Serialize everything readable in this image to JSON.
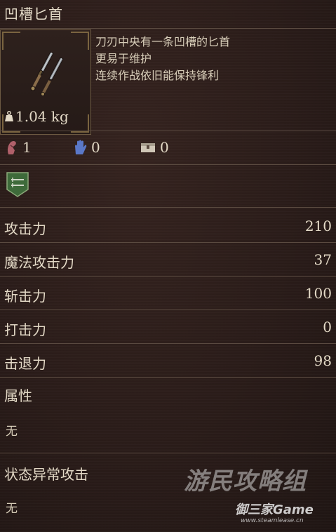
{
  "item": {
    "name": "凹槽匕首",
    "weight": "1.04 kg",
    "description": [
      "刀刃中央有一条凹槽的匕首",
      "更易于维护",
      "连续作战依旧能保持锋利"
    ]
  },
  "requirements": [
    {
      "icon": "strength-arm-icon",
      "value": "1"
    },
    {
      "icon": "magic-hand-icon",
      "value": "0"
    },
    {
      "icon": "chest-icon",
      "value": "0"
    }
  ],
  "class_badge_icon": "dagger-class-badge-icon",
  "stats": [
    {
      "label": "攻击力",
      "value": "210"
    },
    {
      "label": "魔法攻击力",
      "value": "37"
    },
    {
      "label": "斩击力",
      "value": "100"
    },
    {
      "label": "打击力",
      "value": "0"
    },
    {
      "label": "击退力",
      "value": "98"
    }
  ],
  "attribute": {
    "label": "属性",
    "value": "无"
  },
  "status_attack": {
    "label": "状态异常攻击",
    "value": "无"
  },
  "watermark": {
    "line1": "游民攻略组",
    "line2": "御三家Game",
    "line3": "www.steamlease.cn"
  },
  "colors": {
    "background": "#2a1d1a",
    "text": "#e3d9c6",
    "divider": "#5a4a40",
    "frame_gold": "#7a6440",
    "strength_icon": "#b0606a",
    "magic_icon": "#5a78c8",
    "badge_green": "#3e6a3a"
  }
}
